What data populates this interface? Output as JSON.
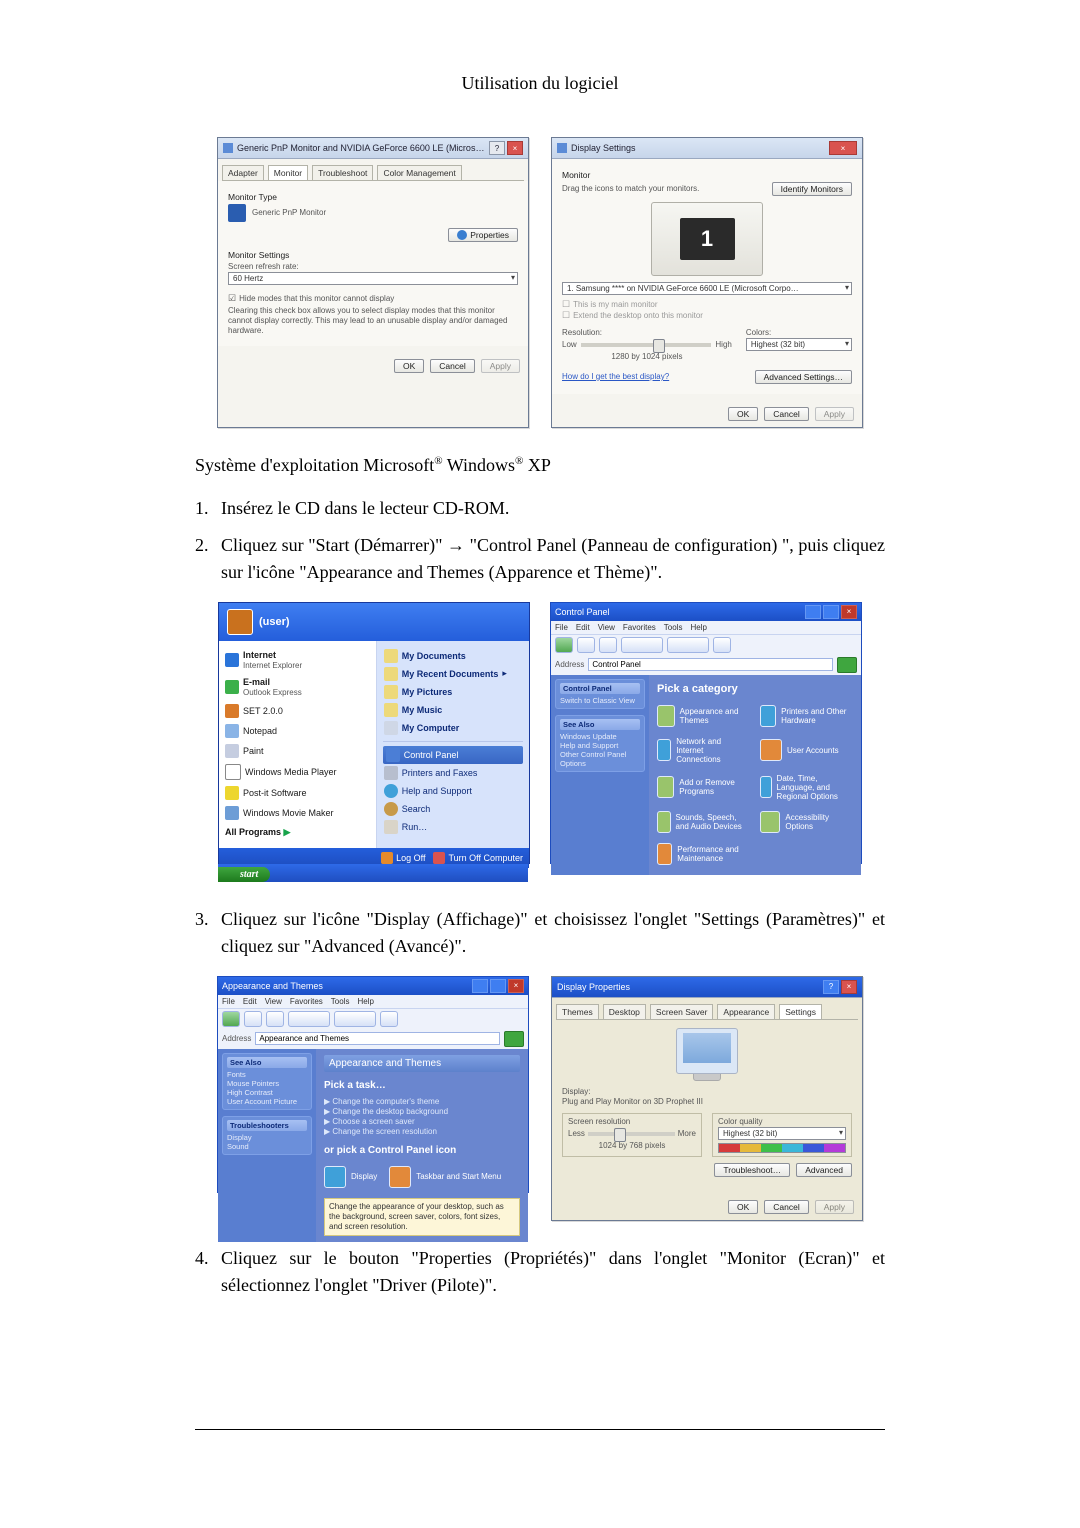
{
  "page_header": "Utilisation du logiciel",
  "os_line_parts": {
    "a": "Système d'exploitation Microsoft",
    "b": " Windows",
    "c": " XP"
  },
  "steps": {
    "s1": "Insérez le CD dans le lecteur CD-ROM.",
    "s2": "Cliquez sur \"Start (Démarrer)\" → \"Control Panel (Panneau de configuration) \", puis cliquez sur l'icône \"Appearance and Themes (Apparence et Thème)\".",
    "s3": "Cliquez sur l'icône \"Display (Affichage)\" et choisissez l'onglet \"Settings (Paramètres)\" et cliquez sur \"Advanced (Avancé)\".",
    "s4": "Cliquez sur le bouton \"Properties (Propriétés)\" dans l'onglet \"Monitor (Ecran)\" et sélectionnez l'onglet \"Driver (Pilote)\"."
  },
  "dlg_monitor_props": {
    "title": "Generic PnP Monitor and NVIDIA GeForce 6600 LE (Microsoft Co…",
    "tabs": {
      "adapter": "Adapter",
      "monitor": "Monitor",
      "troubleshoot": "Troubleshoot",
      "color": "Color Management"
    },
    "section_monitor_type": "Monitor Type",
    "monitor_name": "Generic PnP Monitor",
    "btn_properties": "Properties",
    "section_monitor_settings": "Monitor Settings",
    "refresh_label": "Screen refresh rate:",
    "refresh_value": "60 Hertz",
    "hide_modes_label": "Hide modes that this monitor cannot display",
    "hide_modes_desc": "Clearing this check box allows you to select display modes that this monitor cannot display correctly. This may lead to an unusable display and/or damaged hardware.",
    "btn_ok": "OK",
    "btn_cancel": "Cancel",
    "btn_apply": "Apply"
  },
  "dlg_display_settings": {
    "title": "Display Settings",
    "section": "Monitor",
    "drag_text": "Drag the icons to match your monitors.",
    "identify": "Identify Monitors",
    "monitor_combo": "1. Samsung **** on NVIDIA GeForce 6600 LE (Microsoft Corpo…",
    "chk_primary": "This is my main monitor",
    "chk_extend": "Extend the desktop onto this monitor",
    "res_label": "Resolution:",
    "res_low": "Low",
    "res_high": "High",
    "res_value": "1280 by 1024 pixels",
    "colors_label": "Colors:",
    "colors_value": "Highest (32 bit)",
    "best_display_link": "How do I get the best display?",
    "adv": "Advanced Settings…",
    "btn_ok": "OK",
    "btn_cancel": "Cancel",
    "btn_apply": "Apply"
  },
  "start_menu": {
    "user": "(user)",
    "left": {
      "internet": "Internet",
      "internet_sub": "Internet Explorer",
      "email": "E-mail",
      "email_sub": "Outlook Express",
      "set_access": "SET 2.0.0",
      "notepad": "Notepad",
      "paint": "Paint",
      "wmp": "Windows Media Player",
      "postit": "Post-it Software",
      "movie": "Windows Movie Maker",
      "all_programs": "All Programs"
    },
    "right": {
      "my_docs": "My Documents",
      "my_recent": "My Recent Documents",
      "my_pics": "My Pictures",
      "my_music": "My Music",
      "my_computer": "My Computer",
      "control_panel": "Control Panel",
      "printers": "Printers and Faxes",
      "help": "Help and Support",
      "search": "Search",
      "run": "Run…"
    },
    "logoff": "Log Off",
    "turnoff": "Turn Off Computer",
    "start": "start"
  },
  "control_panel": {
    "title": "Control Panel",
    "menus": {
      "file": "File",
      "edit": "Edit",
      "view": "View",
      "fav": "Favorites",
      "tools": "Tools",
      "help": "Help"
    },
    "addr_label": "Address",
    "addr_value": "Control Panel",
    "side_sw_heading": "Control Panel",
    "side_sw_item": "Switch to Classic View",
    "side_see_heading": "See Also",
    "see1": "Windows Update",
    "see2": "Help and Support",
    "see3": "Other Control Panel Options",
    "pick": "Pick a category",
    "cat_appearance": "Appearance and Themes",
    "cat_printers": "Printers and Other Hardware",
    "cat_network": "Network and Internet Connections",
    "cat_useracc": "User Accounts",
    "cat_addremove": "Add or Remove Programs",
    "cat_date": "Date, Time, Language, and Regional Options",
    "cat_sound": "Sounds, Speech, and Audio Devices",
    "cat_access": "Accessibility Options",
    "cat_perf": "Performance and Maintenance"
  },
  "appearance_panel": {
    "title": "Appearance and Themes",
    "side_see_heading": "See Also",
    "see1": "Fonts",
    "see2": "Mouse Pointers",
    "see3": "High Contrast",
    "see4": "User Account Picture",
    "side_trouble": "Troubleshooters",
    "tr1": "Display",
    "tr2": "Sound",
    "heading_task": "Pick a task…",
    "t1": "Change the computer's theme",
    "t2": "Change the desktop background",
    "t3": "Choose a screen saver",
    "t4": "Change the screen resolution",
    "heading_pick": "or pick a Control Panel icon",
    "p1": "Display",
    "p2": "Taskbar and Start Menu",
    "p_desc": "Change the appearance of your desktop, such as the background, screen saver, colors, font sizes, and screen resolution."
  },
  "display_properties": {
    "title": "Display Properties",
    "tabs": {
      "themes": "Themes",
      "desktop": "Desktop",
      "saver": "Screen Saver",
      "appearance": "Appearance",
      "settings": "Settings"
    },
    "display_label": "Display:",
    "display_value": "Plug and Play Monitor on 3D Prophet III",
    "res_label": "Screen resolution",
    "res_less": "Less",
    "res_more": "More",
    "res_value": "1024 by 768 pixels",
    "color_label": "Color quality",
    "color_value": "Highest (32 bit)",
    "troubleshoot": "Troubleshoot…",
    "advanced": "Advanced",
    "ok": "OK",
    "cancel": "Cancel",
    "apply": "Apply"
  }
}
